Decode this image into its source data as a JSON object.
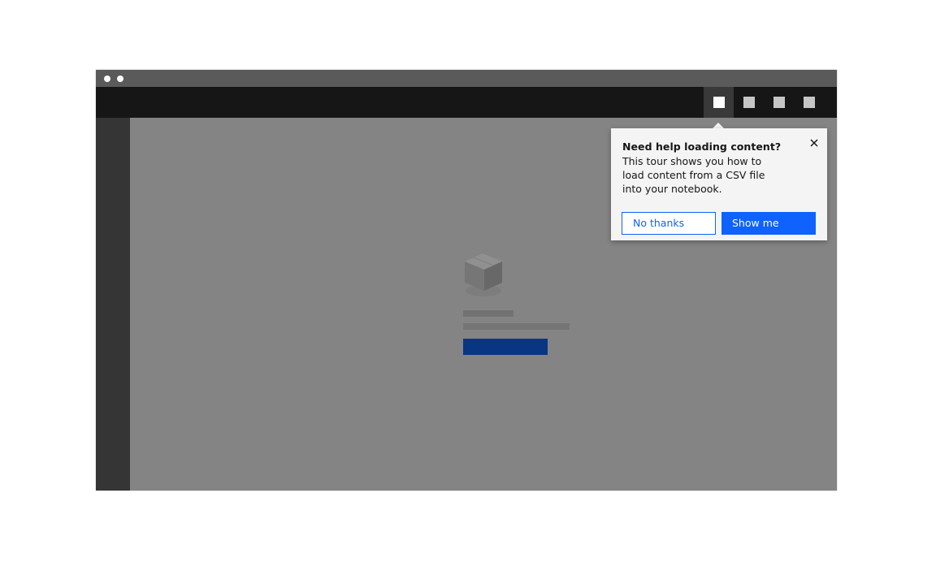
{
  "window": {
    "titlebar_dots": [
      "dot-1",
      "dot-2"
    ]
  },
  "header": {
    "actions": [
      {
        "name": "header-action-1",
        "active": true
      },
      {
        "name": "header-action-2",
        "active": false
      },
      {
        "name": "header-action-3",
        "active": false
      },
      {
        "name": "header-action-4",
        "active": false
      }
    ]
  },
  "empty_state": {
    "icon": "box-icon",
    "button_color": "#0a3a8c"
  },
  "popover": {
    "title": "Need help loading content?",
    "body": "This tour shows you how to load content from a CSV file into your notebook.",
    "close_icon": "close-icon",
    "secondary_button": "No thanks",
    "primary_button": "Show me",
    "accent_color": "#0f62fe"
  }
}
